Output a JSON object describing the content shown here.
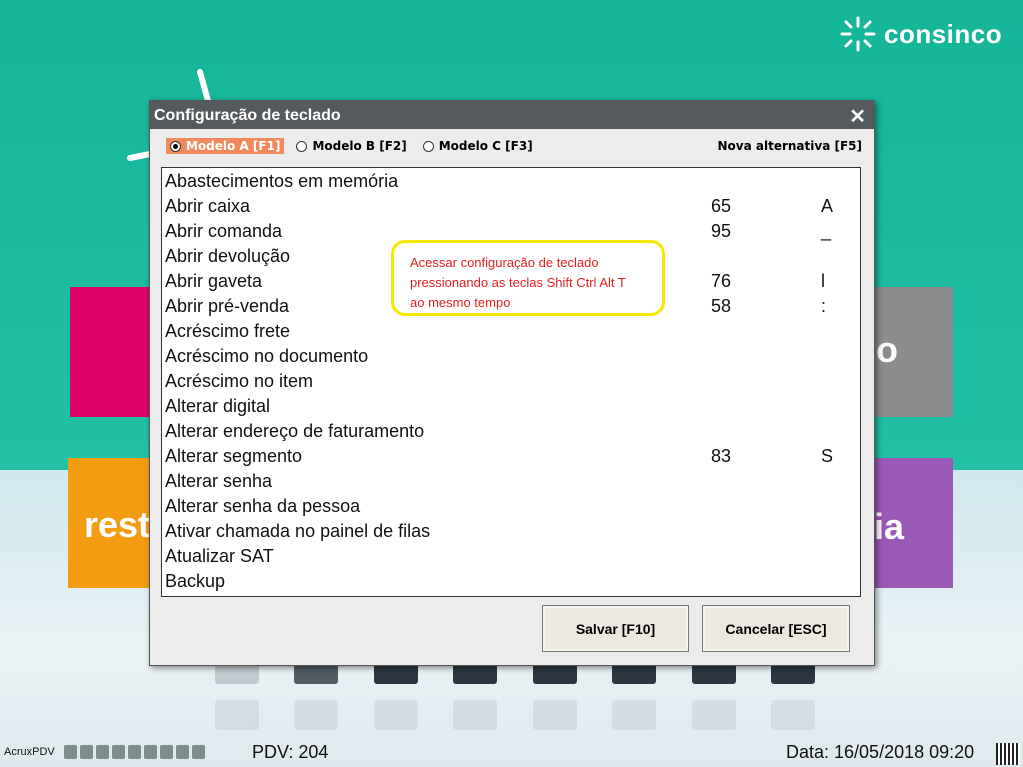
{
  "brand": {
    "logo_text": "consinco"
  },
  "tiles": {
    "orange_text": "rest",
    "purple_text": "ia",
    "gray_text": "o"
  },
  "dialog": {
    "title": "Configuração de teclado",
    "close_glyph": "✕",
    "radios": [
      {
        "label": "Modelo A  [F1]",
        "selected": true
      },
      {
        "label": "Modelo B  [F2]",
        "selected": false
      },
      {
        "label": "Modelo C  [F3]",
        "selected": false
      }
    ],
    "alternative_label": "Nova alternativa [F5]",
    "rows": [
      {
        "name": "Abastecimentos em memória",
        "code": "",
        "key": ""
      },
      {
        "name": "Abrir caixa",
        "code": "65",
        "key": "A"
      },
      {
        "name": "Abrir comanda",
        "code": "95",
        "key": "_"
      },
      {
        "name": "Abrir devolução",
        "code": "",
        "key": ""
      },
      {
        "name": "Abrir gaveta",
        "code": "76",
        "key": "l"
      },
      {
        "name": "Abrir pré-venda",
        "code": "58",
        "key": ":"
      },
      {
        "name": "Acréscimo frete",
        "code": "",
        "key": ""
      },
      {
        "name": "Acréscimo no documento",
        "code": "",
        "key": ""
      },
      {
        "name": "Acréscimo no item",
        "code": "",
        "key": ""
      },
      {
        "name": "Alterar digital",
        "code": "",
        "key": ""
      },
      {
        "name": "Alterar endereço de faturamento",
        "code": "",
        "key": ""
      },
      {
        "name": "Alterar segmento",
        "code": "83",
        "key": "S"
      },
      {
        "name": "Alterar senha",
        "code": "",
        "key": ""
      },
      {
        "name": "Alterar senha da pessoa",
        "code": "",
        "key": ""
      },
      {
        "name": "Ativar chamada no painel de filas",
        "code": "",
        "key": ""
      },
      {
        "name": "Atualizar SAT",
        "code": "",
        "key": ""
      },
      {
        "name": "Backup",
        "code": "",
        "key": ""
      }
    ],
    "save_label": "Salvar [F10]",
    "cancel_label": "Cancelar [ESC]"
  },
  "callout": {
    "line1": "Acessar configuração de teclado",
    "line2": "pressionando as teclas Shift Ctrl Alt T",
    "line3": "ao mesmo tempo"
  },
  "statusbar": {
    "app_name": "AcruxPDV",
    "pdv": "PDV: 204",
    "date": "Data: 16/05/2018 09:20"
  },
  "colors": {
    "selected_radio": "#f08a5d",
    "callout_border": "#f3ea00",
    "callout_text": "#e2201f"
  }
}
